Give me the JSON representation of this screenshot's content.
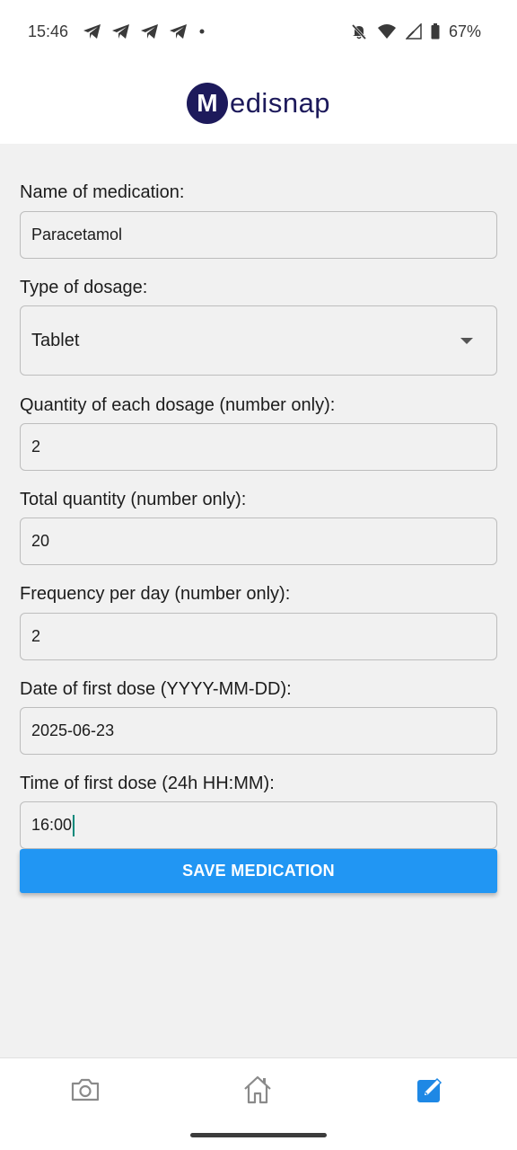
{
  "status_bar": {
    "time": "15:46",
    "battery": "67%",
    "icons": [
      "telegram-icon",
      "telegram-icon",
      "telegram-icon",
      "telegram-icon",
      "dot-icon",
      "mute-icon",
      "wifi-icon",
      "signal-icon",
      "battery-icon"
    ]
  },
  "header": {
    "logo_letter": "M",
    "logo_text": "edisnap"
  },
  "form": {
    "name": {
      "label": "Name of medication:",
      "value": "Paracetamol"
    },
    "dosage_type": {
      "label": "Type of dosage:",
      "value": "Tablet"
    },
    "quantity_each": {
      "label": "Quantity of each dosage (number only):",
      "value": "2"
    },
    "total_quantity": {
      "label": "Total quantity (number only):",
      "value": "20"
    },
    "frequency": {
      "label": "Frequency per day (number only):",
      "value": "2"
    },
    "first_date": {
      "label": "Date of first dose (YYYY-MM-DD):",
      "value": "2025-06-23"
    },
    "first_time": {
      "label": "Time of first dose (24h HH:MM):",
      "value": "16:00"
    },
    "save_label": "SAVE MEDICATION"
  },
  "bottom_nav": {
    "items": [
      {
        "icon": "camera-icon",
        "active": false
      },
      {
        "icon": "home-icon",
        "active": false
      },
      {
        "icon": "edit-icon",
        "active": true
      }
    ]
  },
  "colors": {
    "brand": "#1d1a5b",
    "accent": "#2196f3",
    "cursor": "#00897b"
  }
}
